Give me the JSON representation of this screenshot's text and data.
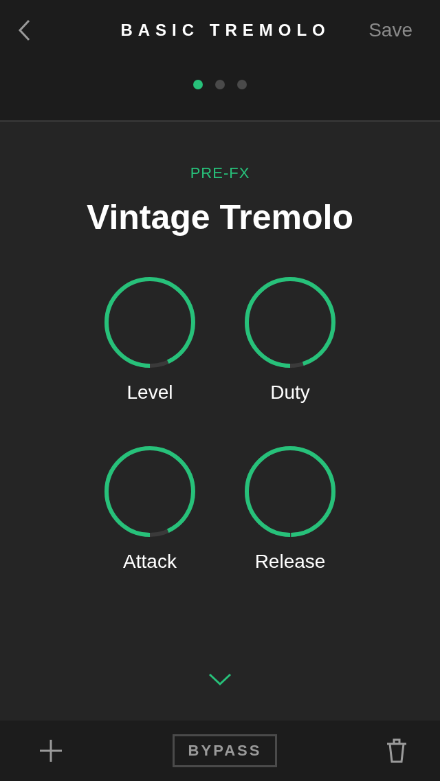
{
  "header": {
    "title": "BASIC TREMOLO",
    "save": "Save"
  },
  "pages": [
    {
      "selected": true
    },
    {
      "selected": false
    },
    {
      "selected": false
    }
  ],
  "effect": {
    "category": "PRE-FX",
    "name": "Vintage Tremolo"
  },
  "knobs": [
    {
      "label": "Level",
      "level": 0.93
    },
    {
      "label": "Duty",
      "level": 0.95
    },
    {
      "label": "Attack",
      "level": 0.93
    },
    {
      "label": "Release",
      "level": 0.995
    }
  ],
  "footer": {
    "bypass": "BYPASS"
  }
}
